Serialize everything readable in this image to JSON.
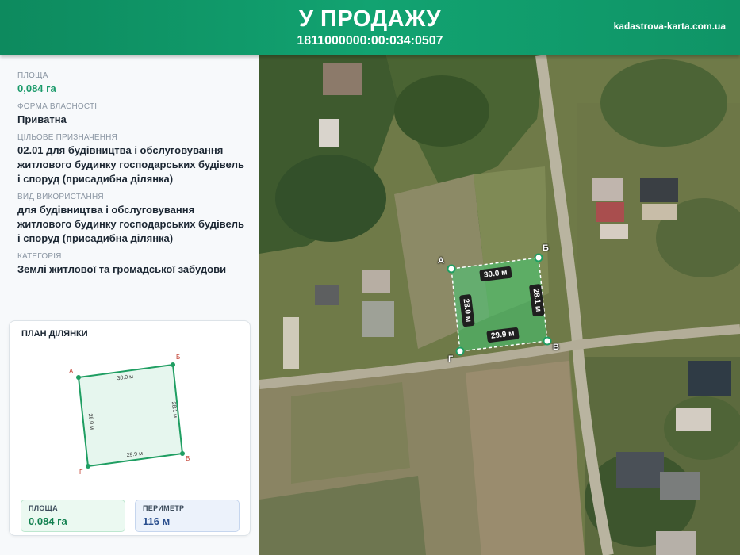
{
  "header": {
    "title": "У ПРОДАЖУ",
    "cadastral_number": "1811000000:00:034:0507",
    "site": "kadastrova-karta.com.ua"
  },
  "fields": [
    {
      "label": "ПЛОЩА",
      "value": "0,084 га",
      "accent": true
    },
    {
      "label": "ФОРМА ВЛАСНОСТІ",
      "value": "Приватна",
      "accent": false
    },
    {
      "label": "ЦІЛЬОВЕ ПРИЗНАЧЕННЯ",
      "value": "02.01 для будівництва і обслуговування житлового будинку господарських будівель і споруд (присадибна ділянка)",
      "accent": false
    },
    {
      "label": "ВИД ВИКОРИСТАННЯ",
      "value": "для будівництва і обслуговування житлового будинку господарських будівель і споруд (присадибна ділянка)",
      "accent": false
    },
    {
      "label": "КАТЕГОРІЯ",
      "value": "Землі житлової та громадської забудови",
      "accent": false
    }
  ],
  "plan": {
    "title": "ПЛАН ДІЛЯНКИ",
    "corners": [
      "А",
      "Б",
      "В",
      "Г"
    ],
    "sides": {
      "ab": "30.0 м",
      "bv": "28.1 м",
      "vg": "29.9 м",
      "ga": "28.0 м"
    },
    "area_label": "ПЛОЩА",
    "area_value": "0,084 га",
    "perimeter_label": "ПЕРИМЕТР",
    "perimeter_value": "116 м"
  },
  "map": {
    "parcel_color": "#36d67a",
    "corners": [
      "А",
      "Б",
      "В",
      "Г"
    ],
    "sides": {
      "ab": "30.0 м",
      "bv": "28.1 м",
      "vg": "29.9 м",
      "ga": "28.0 м"
    }
  }
}
